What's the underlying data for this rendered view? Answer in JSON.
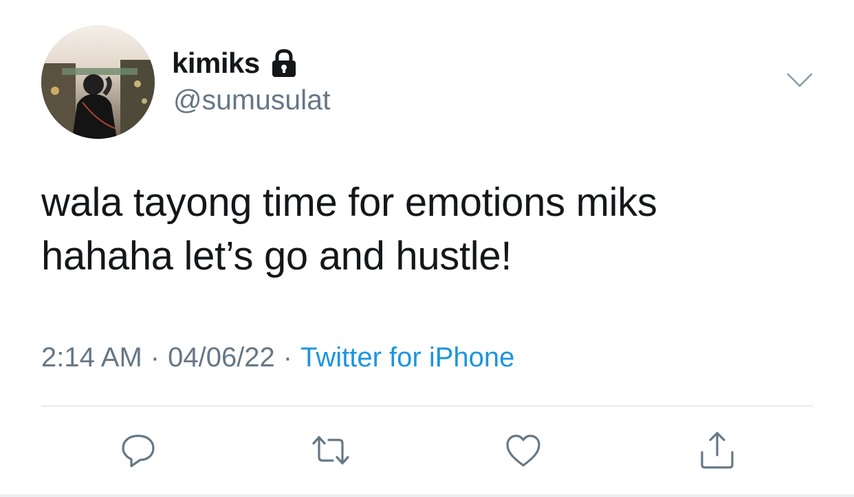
{
  "tweet": {
    "author": {
      "display_name": "kimiks",
      "handle": "@sumusulat",
      "protected_icon": "lock-icon",
      "avatar": "profile-photo"
    },
    "menu_icon": "chevron-down-icon",
    "text_line1": "wala tayong time for emotions miks",
    "text_line2": "hahaha let’s go and hustle!",
    "meta": {
      "time": "2:14 AM",
      "separator": "·",
      "date": "04/06/22",
      "source": "Twitter for iPhone"
    },
    "actions": {
      "reply_icon": "reply-icon",
      "retweet_icon": "retweet-icon",
      "like_icon": "heart-icon",
      "share_icon": "share-icon"
    }
  },
  "colors": {
    "text": "#14171a",
    "secondary": "#657786",
    "link": "#1b95e0",
    "divider": "#d6d9dc"
  }
}
